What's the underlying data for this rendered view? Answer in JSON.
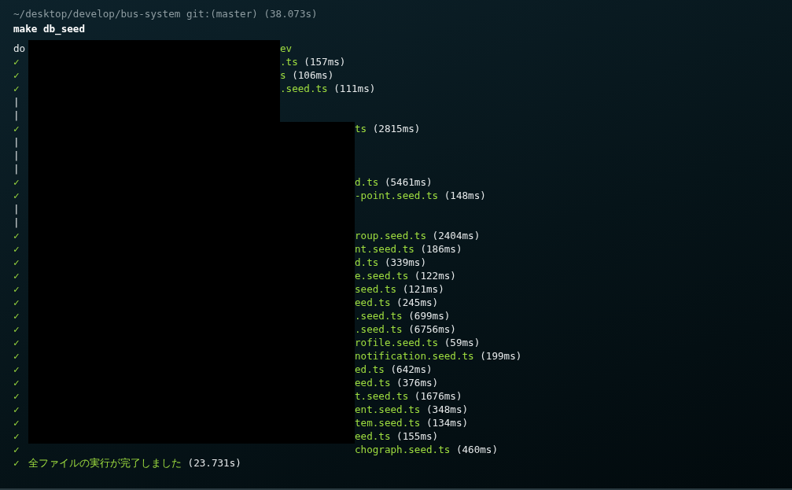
{
  "prompt": {
    "path": "~/desktop/develop/bus-system git:(master) (38.073s)",
    "command": "make db_seed"
  },
  "output": {
    "upper_block": [
      {
        "kind": "plain",
        "mark": "do",
        "text": "ev"
      },
      {
        "kind": "check",
        "mark": "✓",
        "text": ".ts",
        "time": "(157ms)"
      },
      {
        "kind": "check",
        "mark": "✓",
        "text": "s",
        "time": "(106ms)"
      },
      {
        "kind": "check",
        "mark": "✓",
        "text": ".seed.ts",
        "time": "(111ms)"
      },
      {
        "kind": "pipe",
        "mark": "|"
      },
      {
        "kind": "pipe",
        "mark": "|"
      }
    ],
    "lower_block": [
      {
        "kind": "check",
        "mark": "✓",
        "text": "ts",
        "time": "(2815ms)"
      },
      {
        "kind": "pipe",
        "mark": "|"
      },
      {
        "kind": "pipe",
        "mark": "|"
      },
      {
        "kind": "pipe",
        "mark": "|"
      },
      {
        "kind": "check",
        "mark": "✓",
        "text": "d.ts",
        "time": "(5461ms)"
      },
      {
        "kind": "check",
        "mark": "✓",
        "text": "-point.seed.ts",
        "time": "(148ms)"
      },
      {
        "kind": "pipe",
        "mark": "|"
      },
      {
        "kind": "pipe",
        "mark": "|"
      },
      {
        "kind": "check",
        "mark": "✓",
        "text": "roup.seed.ts",
        "time": "(2404ms)"
      },
      {
        "kind": "check",
        "mark": "✓",
        "text": "nt.seed.ts",
        "time": "(186ms)"
      },
      {
        "kind": "check",
        "mark": "✓",
        "text": "d.ts",
        "time": "(339ms)"
      },
      {
        "kind": "check",
        "mark": "✓",
        "text": "e.seed.ts",
        "time": "(122ms)"
      },
      {
        "kind": "check",
        "mark": "✓",
        "text": "seed.ts",
        "time": "(121ms)"
      },
      {
        "kind": "check",
        "mark": "✓",
        "text": "eed.ts",
        "time": "(245ms)"
      },
      {
        "kind": "check",
        "mark": "✓",
        "text": ".seed.ts",
        "time": "(699ms)"
      },
      {
        "kind": "check",
        "mark": "✓",
        "text": ".seed.ts",
        "time": "(6756ms)"
      },
      {
        "kind": "check",
        "mark": "✓",
        "text": "rofile.seed.ts",
        "time": "(59ms)"
      },
      {
        "kind": "check",
        "mark": "✓",
        "text": "notification.seed.ts",
        "time": "(199ms)"
      },
      {
        "kind": "check",
        "mark": "✓",
        "text": "ed.ts",
        "time": "(642ms)"
      },
      {
        "kind": "check",
        "mark": "✓",
        "text": "eed.ts",
        "time": "(376ms)"
      },
      {
        "kind": "check",
        "mark": "✓",
        "text": "t.seed.ts",
        "time": "(1676ms)"
      },
      {
        "kind": "check",
        "mark": "✓",
        "text": "ent.seed.ts",
        "time": "(348ms)"
      },
      {
        "kind": "check",
        "mark": "✓",
        "text": "tem.seed.ts",
        "time": "(134ms)"
      },
      {
        "kind": "check",
        "mark": "✓",
        "text": "eed.ts",
        "time": "(155ms)"
      },
      {
        "kind": "check",
        "mark": "✓",
        "text": "chograph.seed.ts",
        "time": "(460ms)"
      }
    ],
    "footer": {
      "kind": "check",
      "mark": "✓",
      "text": "全ファイルの実行が完了しました",
      "time": "(23.731s)"
    }
  }
}
